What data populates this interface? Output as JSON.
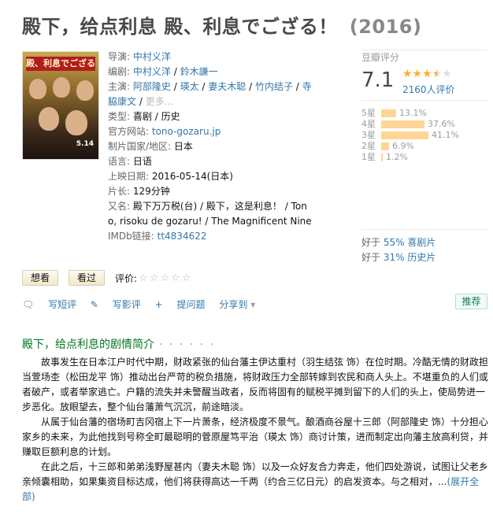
{
  "title": "殿下，给点利息 殿、利息でござる！",
  "year": "(2016)",
  "poster": {
    "title_text": "殿、利息でござる!",
    "date_text": "5.14"
  },
  "info": {
    "director_label": "导演:",
    "director": "中村义洋",
    "writer_label": "编剧:",
    "writers": [
      "中村义洋",
      "鈴木謙一"
    ],
    "cast_label": "主演:",
    "cast": [
      "阿部隆史",
      "瑛太",
      "妻夫木聪",
      "竹内结子",
      "寺脇康文"
    ],
    "cast_more": "更多...",
    "genre_label": "类型:",
    "genres": [
      "喜剧",
      "历史"
    ],
    "site_label": "官方网站:",
    "site": "tono-gozaru.jp",
    "country_label": "制片国家/地区:",
    "country": "日本",
    "lang_label": "语言:",
    "lang": "日语",
    "release_label": "上映日期:",
    "release": "2016-05-14(日本)",
    "runtime_label": "片长:",
    "runtime": "129分钟",
    "aka_label": "又名:",
    "aka": "殿下万万税(台) / 殿下，这是利息！ / Tono, risoku de gozaru! / The Magnificent Nine",
    "imdb_label": "IMDb链接:",
    "imdb": "tt4834622"
  },
  "rating": {
    "header": "豆瓣评分",
    "score": "7.1",
    "stars_filled": 3.5,
    "votes": "2160人评价",
    "distribution": [
      {
        "label": "5星",
        "pct": "13.1%",
        "value": 13.1
      },
      {
        "label": "4星",
        "pct": "37.6%",
        "value": 37.6
      },
      {
        "label": "3星",
        "pct": "41.1%",
        "value": 41.1
      },
      {
        "label": "2星",
        "pct": "6.9%",
        "value": 6.9
      },
      {
        "label": "1星",
        "pct": "1.2%",
        "value": 1.2
      }
    ],
    "better1_prefix": "好于",
    "better1_pct": "55% 喜剧片",
    "better2_prefix": "好于",
    "better2_pct": "31% 历史片"
  },
  "actions": {
    "want": "想看",
    "seen": "看过",
    "rate_label": "评价:",
    "write_short": "写短评",
    "write_review": "写影评",
    "ask": "提问题",
    "share": "分享到",
    "recommend": "推荐"
  },
  "summary": {
    "title": "殿下，给点利息的剧情简介",
    "dots": "· · · · · ·",
    "p1": "故事发生在日本江户时代中期，财政紧张的仙台藩主伊达重村（羽生结弦 饰）在位时期。冷酷无情的财政担当萱场杢（松田龙平 饰）推动出台严苛的税负措施，将财政压力全部转嫁到农民和商人头上。不堪重负的人们或者破产，或者举家逃亡。户籍的流失并未警醒当政者，反而将固有的赋税平摊到留下的人们的头上，使局势进一步恶化。放眼望去，整个仙台藩萧气沉沉，前途暗淡。",
    "p2": "从属于仙台藩的宿场町吉冈宿上下一片萧条，经济极度不景气。酿酒商谷屋十三郎（阿部隆史 饰）十分担心家乡的未来，为此他找到号称全町最聪明的菅原屋笃平治（瑛太 饰）商讨计策，进而制定出向藩主放高利贷，并赚取巨额利息的计划。",
    "p3": "在此之后，十三郎和弟弟浅野屋甚内（妻夫木聪 饰）以及一众好友合力奔走，他们四处游说，试图让父老乡亲倾囊相助，如果集资目标达成，他们将获得高达一千两（约合三亿日元）的启发资本。与之相对，...",
    "expand": "(展开全部)"
  }
}
